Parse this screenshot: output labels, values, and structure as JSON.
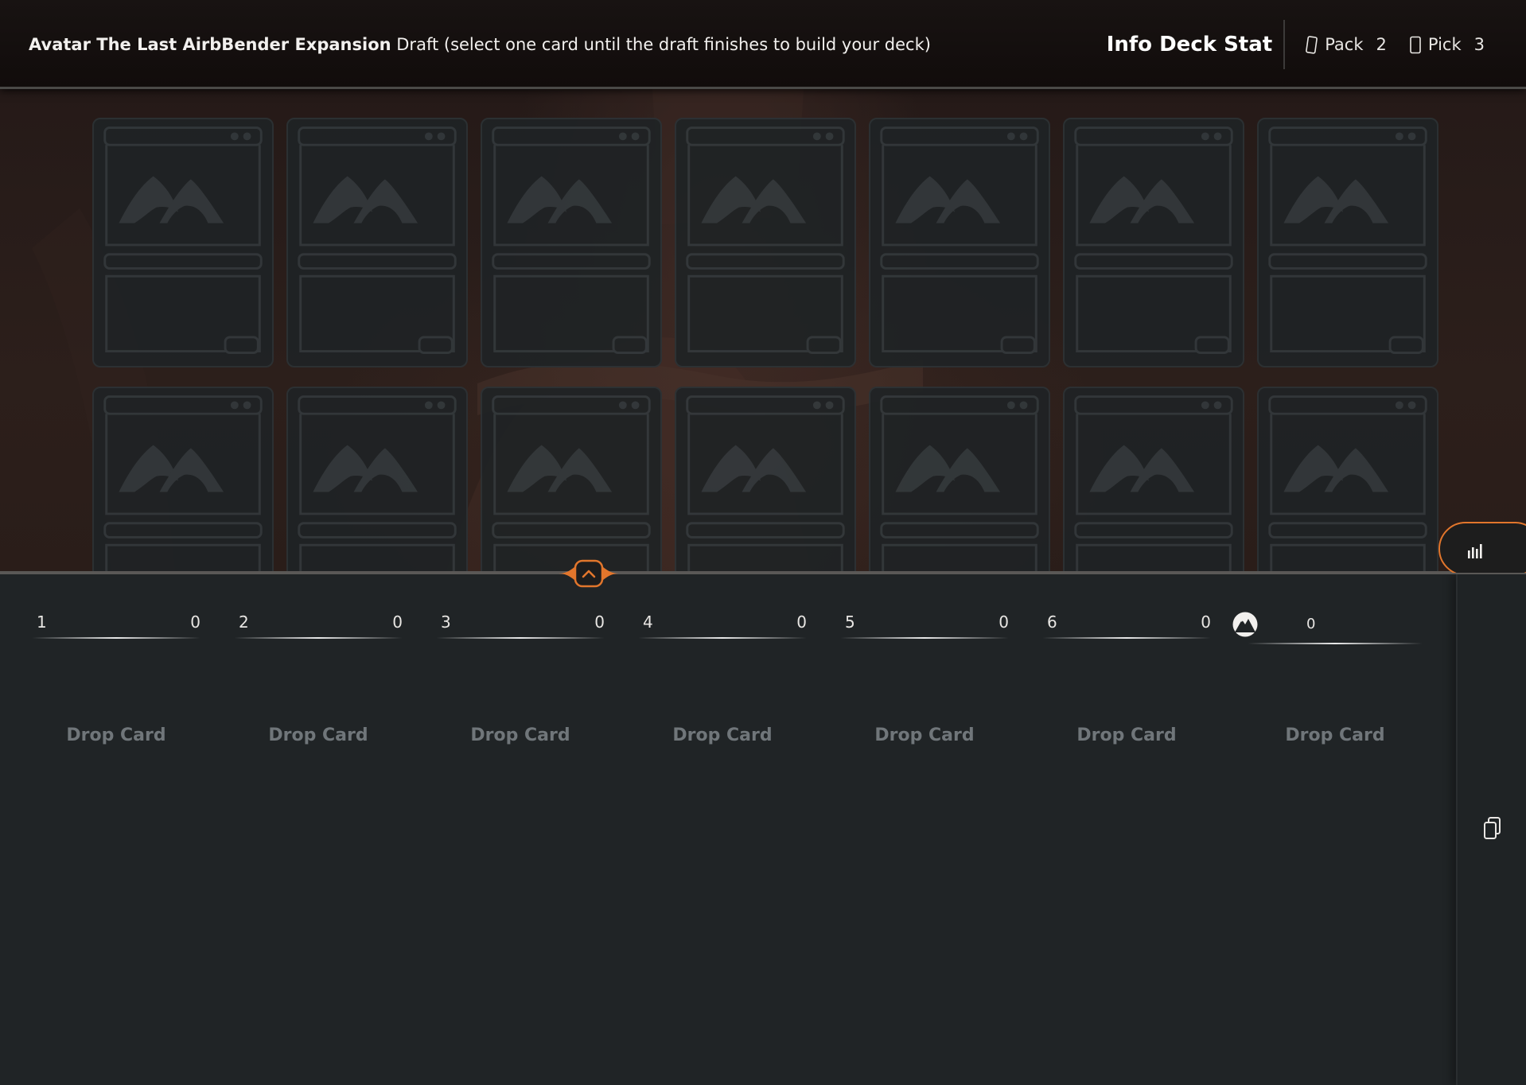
{
  "header": {
    "set_name": "Avatar The Last AirbBender Expansion",
    "subtitle": "Draft (select one card until the draft finishes to build your deck)",
    "info_deck_stat": "Info Deck Stat",
    "pack_label": "Pack",
    "pack_number": "2",
    "pick_label": "Pick",
    "pick_number": "3"
  },
  "pick_grid": {
    "rows_visible": 2,
    "cards_per_row": 7,
    "card_state": "placeholder"
  },
  "deck": {
    "columns": [
      {
        "label": "1",
        "count": "0"
      },
      {
        "label": "2",
        "count": "0"
      },
      {
        "label": "3",
        "count": "0"
      },
      {
        "label": "4",
        "count": "0"
      },
      {
        "label": "5",
        "count": "0"
      },
      {
        "label": "6",
        "count": "0"
      }
    ],
    "lands": {
      "icon": "mountain-land-icon",
      "count": "0"
    },
    "drop_labels": [
      "Drop Card",
      "Drop Card",
      "Drop Card",
      "Drop Card",
      "Drop Card",
      "Drop Card",
      "Drop Card"
    ]
  },
  "icons": {
    "stats": "bar-chart-icon",
    "collapse": "chevron-up-icon",
    "deck": "card-stack-icon",
    "pack": "card-icon",
    "pick": "card-icon"
  },
  "colors": {
    "accent": "#e2762c",
    "panel": "#202426",
    "header": "#120d0c"
  }
}
